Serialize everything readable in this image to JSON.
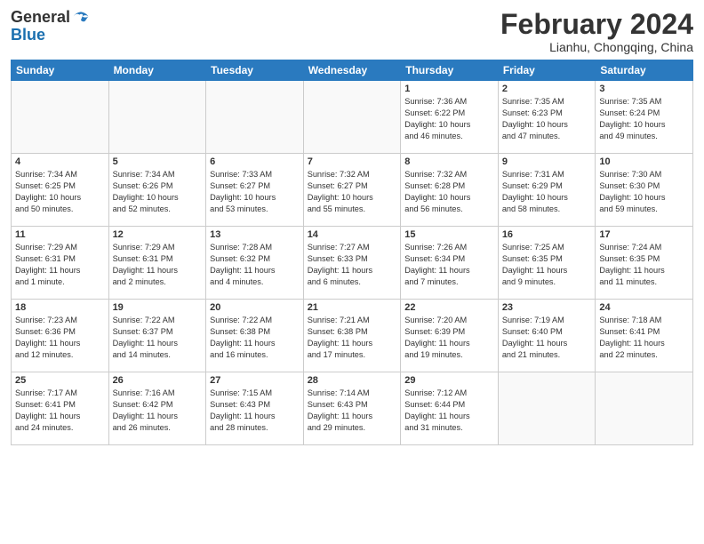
{
  "header": {
    "logo_line1": "General",
    "logo_line2": "Blue",
    "title": "February 2024",
    "subtitle": "Lianhu, Chongqing, China"
  },
  "days_of_week": [
    "Sunday",
    "Monday",
    "Tuesday",
    "Wednesday",
    "Thursday",
    "Friday",
    "Saturday"
  ],
  "weeks": [
    [
      {
        "day": "",
        "info": ""
      },
      {
        "day": "",
        "info": ""
      },
      {
        "day": "",
        "info": ""
      },
      {
        "day": "",
        "info": ""
      },
      {
        "day": "1",
        "info": "Sunrise: 7:36 AM\nSunset: 6:22 PM\nDaylight: 10 hours\nand 46 minutes."
      },
      {
        "day": "2",
        "info": "Sunrise: 7:35 AM\nSunset: 6:23 PM\nDaylight: 10 hours\nand 47 minutes."
      },
      {
        "day": "3",
        "info": "Sunrise: 7:35 AM\nSunset: 6:24 PM\nDaylight: 10 hours\nand 49 minutes."
      }
    ],
    [
      {
        "day": "4",
        "info": "Sunrise: 7:34 AM\nSunset: 6:25 PM\nDaylight: 10 hours\nand 50 minutes."
      },
      {
        "day": "5",
        "info": "Sunrise: 7:34 AM\nSunset: 6:26 PM\nDaylight: 10 hours\nand 52 minutes."
      },
      {
        "day": "6",
        "info": "Sunrise: 7:33 AM\nSunset: 6:27 PM\nDaylight: 10 hours\nand 53 minutes."
      },
      {
        "day": "7",
        "info": "Sunrise: 7:32 AM\nSunset: 6:27 PM\nDaylight: 10 hours\nand 55 minutes."
      },
      {
        "day": "8",
        "info": "Sunrise: 7:32 AM\nSunset: 6:28 PM\nDaylight: 10 hours\nand 56 minutes."
      },
      {
        "day": "9",
        "info": "Sunrise: 7:31 AM\nSunset: 6:29 PM\nDaylight: 10 hours\nand 58 minutes."
      },
      {
        "day": "10",
        "info": "Sunrise: 7:30 AM\nSunset: 6:30 PM\nDaylight: 10 hours\nand 59 minutes."
      }
    ],
    [
      {
        "day": "11",
        "info": "Sunrise: 7:29 AM\nSunset: 6:31 PM\nDaylight: 11 hours\nand 1 minute."
      },
      {
        "day": "12",
        "info": "Sunrise: 7:29 AM\nSunset: 6:31 PM\nDaylight: 11 hours\nand 2 minutes."
      },
      {
        "day": "13",
        "info": "Sunrise: 7:28 AM\nSunset: 6:32 PM\nDaylight: 11 hours\nand 4 minutes."
      },
      {
        "day": "14",
        "info": "Sunrise: 7:27 AM\nSunset: 6:33 PM\nDaylight: 11 hours\nand 6 minutes."
      },
      {
        "day": "15",
        "info": "Sunrise: 7:26 AM\nSunset: 6:34 PM\nDaylight: 11 hours\nand 7 minutes."
      },
      {
        "day": "16",
        "info": "Sunrise: 7:25 AM\nSunset: 6:35 PM\nDaylight: 11 hours\nand 9 minutes."
      },
      {
        "day": "17",
        "info": "Sunrise: 7:24 AM\nSunset: 6:35 PM\nDaylight: 11 hours\nand 11 minutes."
      }
    ],
    [
      {
        "day": "18",
        "info": "Sunrise: 7:23 AM\nSunset: 6:36 PM\nDaylight: 11 hours\nand 12 minutes."
      },
      {
        "day": "19",
        "info": "Sunrise: 7:22 AM\nSunset: 6:37 PM\nDaylight: 11 hours\nand 14 minutes."
      },
      {
        "day": "20",
        "info": "Sunrise: 7:22 AM\nSunset: 6:38 PM\nDaylight: 11 hours\nand 16 minutes."
      },
      {
        "day": "21",
        "info": "Sunrise: 7:21 AM\nSunset: 6:38 PM\nDaylight: 11 hours\nand 17 minutes."
      },
      {
        "day": "22",
        "info": "Sunrise: 7:20 AM\nSunset: 6:39 PM\nDaylight: 11 hours\nand 19 minutes."
      },
      {
        "day": "23",
        "info": "Sunrise: 7:19 AM\nSunset: 6:40 PM\nDaylight: 11 hours\nand 21 minutes."
      },
      {
        "day": "24",
        "info": "Sunrise: 7:18 AM\nSunset: 6:41 PM\nDaylight: 11 hours\nand 22 minutes."
      }
    ],
    [
      {
        "day": "25",
        "info": "Sunrise: 7:17 AM\nSunset: 6:41 PM\nDaylight: 11 hours\nand 24 minutes."
      },
      {
        "day": "26",
        "info": "Sunrise: 7:16 AM\nSunset: 6:42 PM\nDaylight: 11 hours\nand 26 minutes."
      },
      {
        "day": "27",
        "info": "Sunrise: 7:15 AM\nSunset: 6:43 PM\nDaylight: 11 hours\nand 28 minutes."
      },
      {
        "day": "28",
        "info": "Sunrise: 7:14 AM\nSunset: 6:43 PM\nDaylight: 11 hours\nand 29 minutes."
      },
      {
        "day": "29",
        "info": "Sunrise: 7:12 AM\nSunset: 6:44 PM\nDaylight: 11 hours\nand 31 minutes."
      },
      {
        "day": "",
        "info": ""
      },
      {
        "day": "",
        "info": ""
      }
    ]
  ]
}
